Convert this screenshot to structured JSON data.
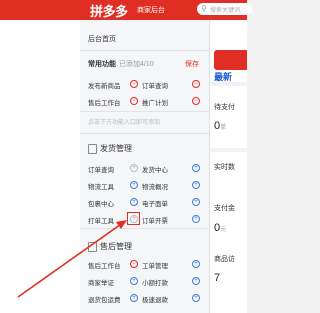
{
  "header": {
    "logo": "拼多多",
    "subtitle": "商家后台",
    "search_placeholder": "搜索关键词"
  },
  "panel": {
    "home": "后台首页",
    "quick_title": "常用功能",
    "quick_count": "已添加4/10",
    "save": "保存",
    "quick_items": [
      "发布新商品",
      "订单查询",
      "售后工作台",
      "推广计划"
    ],
    "hint": "点击下方功能入口即可添加",
    "shipping": {
      "title": "发货管理",
      "items": [
        "订单查询",
        "发货中心",
        "物流工具",
        "物流概况",
        "包裹中心",
        "电子面单",
        "打单工具",
        "订单开票"
      ]
    },
    "aftersale": {
      "title": "售后管理",
      "items": [
        "售后工作台",
        "工单管理",
        "商家举证",
        "小额打款",
        "退货包运费",
        "极速退款"
      ]
    }
  },
  "right": {
    "latest": "最新",
    "pending": "待支付",
    "pending_value": "0",
    "pending_unit": "单",
    "realtime": "实时数",
    "paid": "支付金",
    "paid_value": "0",
    "paid_unit": "元",
    "goods": "商品访",
    "goods_value": "7"
  }
}
